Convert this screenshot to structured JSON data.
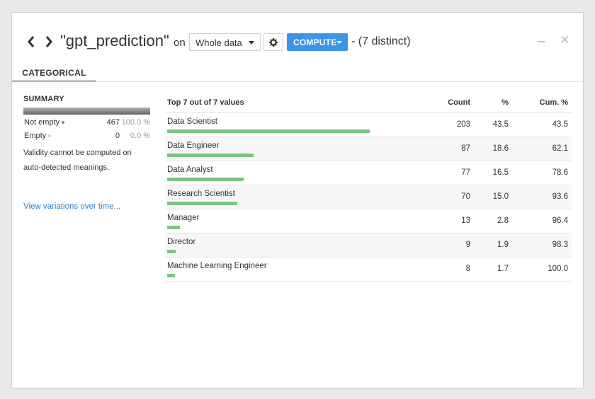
{
  "header": {
    "column_title": "\"gpt_prediction\"",
    "on_label": "on",
    "sample_select": "Whole data",
    "compute_label": "COMPUTE",
    "distinct_label": "- (7 distinct)"
  },
  "tabs": [
    {
      "label": "CATEGORICAL",
      "active": true
    }
  ],
  "summary": {
    "title": "SUMMARY",
    "not_empty": {
      "label": "Not empty",
      "count": "467",
      "pct": "100.0 %"
    },
    "empty": {
      "label": "Empty",
      "count": "0",
      "pct": "0.0 %"
    },
    "validity_line1": "Validity cannot be computed on",
    "validity_line2": "auto-detected meanings.",
    "variations_link": "View variations over time..."
  },
  "table": {
    "title": "Top 7 out of 7 values",
    "col_count": "Count",
    "col_pct": "%",
    "col_cum": "Cum. %",
    "bar_color": "#7bc67f",
    "rows": [
      {
        "value": "Data Scientist",
        "count": "203",
        "pct": "43.5",
        "cum": "43.5"
      },
      {
        "value": "Data Engineer",
        "count": "87",
        "pct": "18.6",
        "cum": "62.1"
      },
      {
        "value": "Data Analyst",
        "count": "77",
        "pct": "16.5",
        "cum": "78.6"
      },
      {
        "value": "Research Scientist",
        "count": "70",
        "pct": "15.0",
        "cum": "93.6"
      },
      {
        "value": "Manager",
        "count": "13",
        "pct": "2.8",
        "cum": "96.4"
      },
      {
        "value": "Director",
        "count": "9",
        "pct": "1.9",
        "cum": "98.3"
      },
      {
        "value": "Machine Learning Engineer",
        "count": "8",
        "pct": "1.7",
        "cum": "100.0"
      }
    ]
  },
  "colors": {
    "accent": "#3c95e8",
    "link": "#2a7fc6"
  }
}
